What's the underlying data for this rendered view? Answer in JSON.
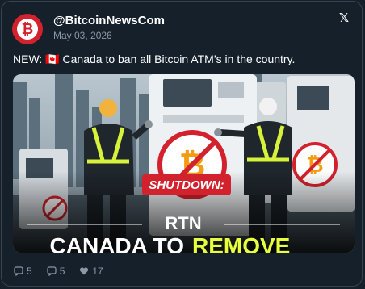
{
  "post": {
    "handle": "@BitcoinNewsCom",
    "date": "May 03, 2026",
    "text": "NEW: 🇨🇦 Canada to ban all Bitcoin ATM’s in the country.",
    "avatar_symbol": "₿",
    "x_symbol": "𝕏"
  },
  "image": {
    "shutdown_label": "SHUTDOWN:",
    "brand": "RTN",
    "headline_white": "CANADA TO",
    "headline_yellow": "REMOVE"
  },
  "actions": {
    "replies": "5",
    "reposts": "5",
    "likes": "17"
  },
  "colors": {
    "background": "#15202b",
    "accent_red": "#d2222d",
    "muted": "#8b98a5",
    "highlight_yellow": "#e7ff3c"
  }
}
